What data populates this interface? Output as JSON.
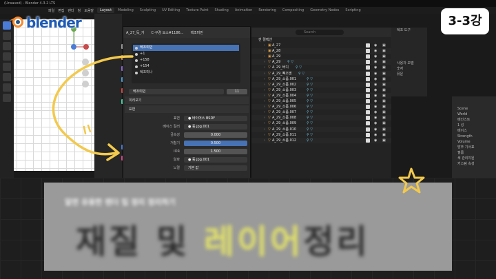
{
  "window": {
    "title": "(Unsaved) - Blender 4.3.2 LTS",
    "menus": [
      "파일",
      "편집",
      "렌더",
      "창",
      "도움말"
    ],
    "workspaces": [
      "Layout",
      "Modeling",
      "Sculpting",
      "UV Editing",
      "Texture Paint",
      "Shading",
      "Animation",
      "Rendering",
      "Compositing",
      "Geometry Nodes",
      "Scripting"
    ],
    "active_workspace": "Layout"
  },
  "logo": {
    "text": "blender"
  },
  "badge": {
    "text": "3-3강"
  },
  "material_panel": {
    "object_name": "A_27_독_가",
    "material_name": "C-구경 요소#1186...",
    "header_right": "렉조미민",
    "slots": [
      {
        "label": "렉조미민",
        "active": true
      },
      {
        "label": "+1",
        "active": false
      },
      {
        "label": "+158",
        "active": false
      },
      {
        "label": "+154",
        "active": false
      },
      {
        "label": "렉조미나",
        "active": false
      }
    ],
    "current_material": "렉조미민",
    "user_count": "11",
    "sections": {
      "preview": "미리보기",
      "surface": "표면"
    },
    "rows": [
      {
        "label": "표면",
        "value": "● 바이어스 BSDF",
        "type": "dark"
      },
      {
        "label": "베이스 컬러",
        "value": "● 동.jpg.001",
        "type": "dark"
      },
      {
        "label": "금속성",
        "value": "0.000",
        "type": "normal"
      },
      {
        "label": "거칠기",
        "value": "0.500",
        "type": "blue"
      },
      {
        "label": "IOR",
        "value": "1.500",
        "type": "normal"
      },
      {
        "label": "알파",
        "value": "● 동.jpg.001",
        "type": "dark"
      },
      {
        "label": "노멀",
        "value": "기본 값",
        "type": "dark"
      }
    ]
  },
  "outliner": {
    "search_placeholder": "Search",
    "scene_label": "씬 컬렉션",
    "rows": [
      {
        "name": "A_27",
        "kind": "collection"
      },
      {
        "name": "A_28",
        "kind": "collection"
      },
      {
        "name": "A_29",
        "kind": "collection"
      },
      {
        "name": "A_29",
        "kind": "mesh"
      },
      {
        "name": "A_29_버디",
        "kind": "mesh"
      },
      {
        "name": "A_29_뻑조명",
        "kind": "mesh"
      },
      {
        "name": "A_29_소품.001",
        "kind": "mesh"
      },
      {
        "name": "A_29_소품.002",
        "kind": "mesh"
      },
      {
        "name": "A_29_소품.003",
        "kind": "mesh"
      },
      {
        "name": "A_29_소품.004",
        "kind": "mesh"
      },
      {
        "name": "A_29_소품.005",
        "kind": "mesh"
      },
      {
        "name": "A_29_소품.006",
        "kind": "mesh"
      },
      {
        "name": "A_29_소품.007",
        "kind": "mesh"
      },
      {
        "name": "A_29_소품.008",
        "kind": "mesh"
      },
      {
        "name": "A_29_소품.009",
        "kind": "mesh"
      },
      {
        "name": "A_29_소품.010",
        "kind": "mesh"
      },
      {
        "name": "A_29_소품.011",
        "kind": "mesh"
      },
      {
        "name": "A_29_소품.012",
        "kind": "mesh"
      }
    ]
  },
  "right_top": {
    "header": "렉조 도구",
    "labels": [
      "사용자 모델",
      "숫자",
      "뮤문"
    ]
  },
  "right_panel": {
    "scene_label": "Scene",
    "world_label": "World",
    "items": [
      "메인스트",
      "1 성",
      "베이스",
      "Strength",
      "Volume",
      "방주 기서표",
      "필름",
      "색 관리지원",
      "커스텀 속성"
    ]
  },
  "banner": {
    "subtitle": "알면 유용한 렌더 팁 정리 정리하기",
    "title_parts": [
      "재질 및 ",
      "레이어",
      "정리"
    ]
  },
  "accent": {
    "blue": "#4772b3",
    "yellow": "#f2c94c",
    "orange": "#e8a64a"
  }
}
